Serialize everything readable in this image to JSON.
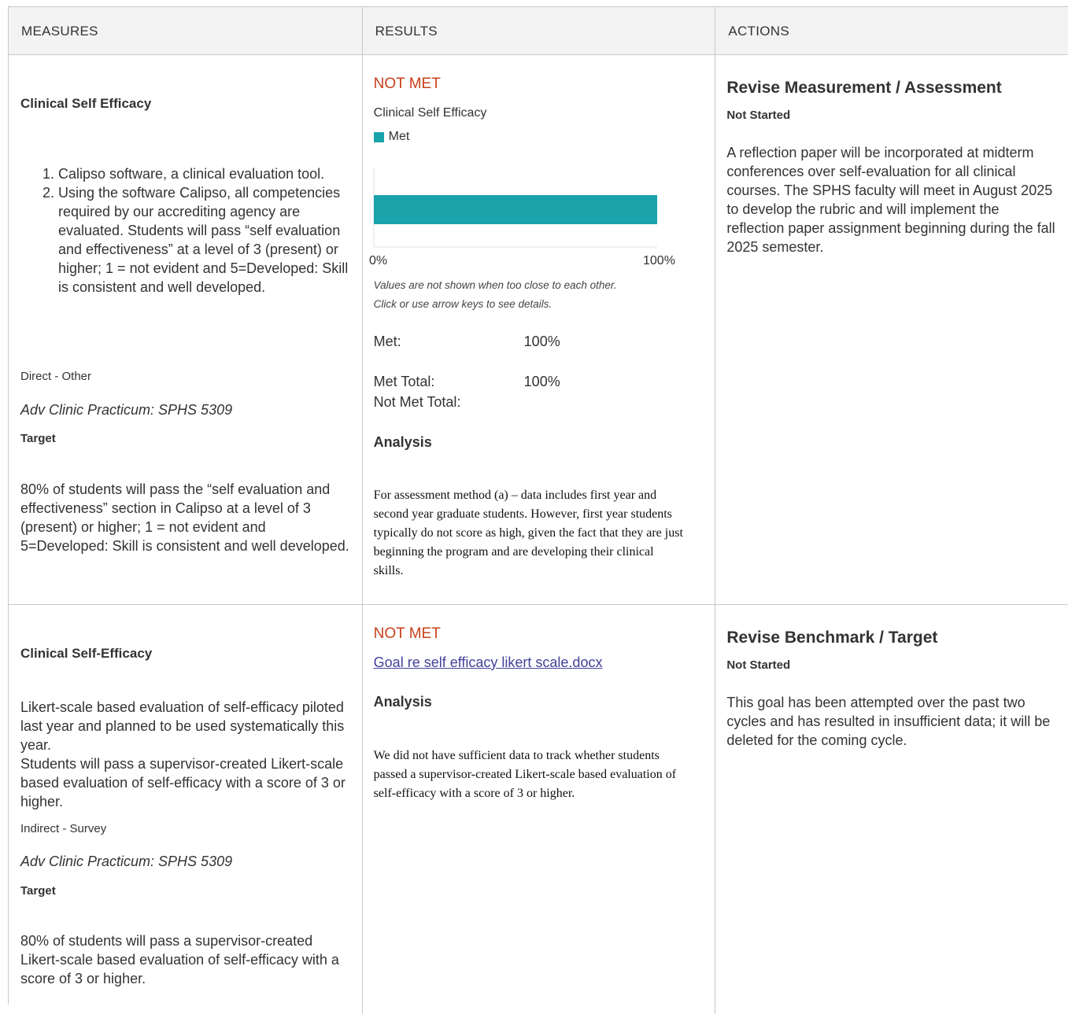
{
  "headers": {
    "measures": "MEASURES",
    "results": "RESULTS",
    "actions": "ACTIONS"
  },
  "rows": [
    {
      "measure": {
        "title": "Clinical Self Efficacy",
        "list": [
          "Calipso software, a clinical evaluation tool.",
          "Using the software Calipso, all competencies required by our accrediting agency are evaluated. Students will pass “self evaluation and effectiveness” at a level of 3 (present) or higher; 1 = not evident and 5=Developed: Skill is consistent and well developed."
        ],
        "method": "Direct - Other",
        "course": "Adv Clinic Practicum: SPHS 5309",
        "target_label": "Target",
        "target": "80% of students will pass the “self evaluation and effectiveness” section in Calipso at a level of 3 (present) or higher; 1 = not evident and 5=Developed: Skill is consistent and well developed."
      },
      "result": {
        "status": "NOT MET",
        "chart_title": "Clinical Self Efficacy",
        "legend": "Met",
        "axis_min_label": "0%",
        "axis_max_label": "100%",
        "note_line1": "Values are not shown when too close to each other.",
        "note_line2": "Click or use arrow keys to see details.",
        "met_label": "Met:",
        "met_value": "100%",
        "met_total_label": "Met Total:",
        "met_total_value": "100%",
        "not_met_total_label": "Not Met Total:",
        "analysis_heading": "Analysis",
        "analysis": "For assessment method (a) – data includes first year and second year graduate students. However, first year students typically do not score as high, given the fact that they are just beginning the program and are developing their clinical skills."
      },
      "action": {
        "title": "Revise Measurement / Assessment",
        "status": "Not Started",
        "text": "A reflection paper will be incorporated at midterm conferences over self-evaluation for all clinical courses. The SPHS faculty will meet in August 2025 to develop the rubric and will implement the reflection paper assignment beginning during the fall 2025 semester."
      }
    },
    {
      "measure": {
        "title": "Clinical Self-Efficacy",
        "description_1": "Likert-scale based evaluation of self-efficacy piloted last year and planned to be used systematically this year.",
        "description_2": "Students will pass a supervisor-created Likert-scale based evaluation of self-efficacy with a score of 3 or higher.",
        "method": "Indirect - Survey",
        "course": "Adv Clinic Practicum: SPHS 5309",
        "target_label": "Target",
        "target": "80% of students will pass a supervisor-created Likert-scale based evaluation of self-efficacy with a score of 3 or higher."
      },
      "result": {
        "status": "NOT MET",
        "attachment": "Goal re self efficacy likert scale.docx",
        "analysis_heading": "Analysis",
        "analysis": "We did not have sufficient data to track whether students passed a supervisor-created Likert-scale based evaluation of self-efficacy with a score of 3 or higher."
      },
      "action": {
        "title": "Revise Benchmark / Target",
        "status": "Not Started",
        "text": "This goal has been attempted over the past two cycles and has resulted in insufficient data; it will be deleted for the coming cycle."
      }
    }
  ],
  "chart_data": {
    "type": "bar",
    "title": "",
    "categories": [
      "Clinical Self Efficacy"
    ],
    "series": [
      {
        "name": "Met",
        "values": [
          100
        ]
      }
    ],
    "xlim": [
      0,
      100
    ],
    "color": "#1aa3ab"
  },
  "colors": {
    "status_not_met": "#c8401a",
    "bar": "#1aa3ab",
    "link": "#44419a"
  }
}
